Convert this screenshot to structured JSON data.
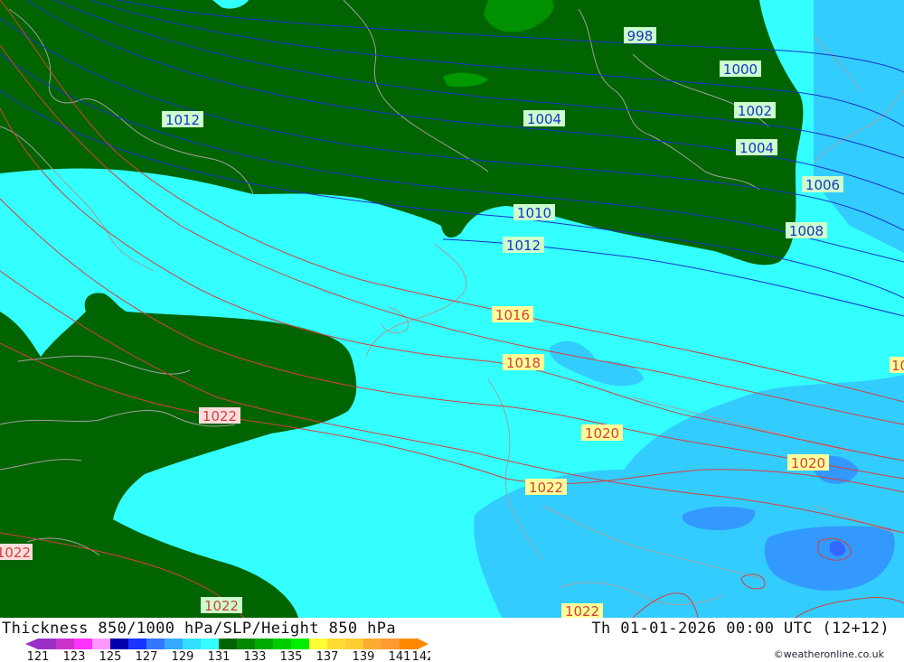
{
  "map": {
    "colors": {
      "land_green": "#006400",
      "cyan": "#33ffff",
      "light_blue": "#33ccff",
      "mid_blue": "#3399ff",
      "dark_blue": "#3366ff",
      "isobar_blue": "#1a33cc",
      "isobar_red": "#d24040",
      "coast": "#a0a0a0"
    },
    "labels": {
      "slp": [
        "998",
        "1000",
        "1002",
        "1004",
        "1006",
        "1008",
        "1010",
        "1012",
        "1004",
        "1012",
        "1016",
        "1018",
        "1020",
        "1020",
        "1022",
        "1022",
        "1022",
        "1022",
        "1022",
        "10"
      ]
    }
  },
  "footer": {
    "title": "Thickness 850/1000 hPa/SLP/Height 850 hPa",
    "datetime": "Th 01-01-2026 00:00 UTC (12+12)",
    "credit": "©weatheronline.co.uk"
  },
  "legend": {
    "ticks": [
      "121",
      "123",
      "125",
      "127",
      "129",
      "131",
      "133",
      "135",
      "137",
      "139",
      "141",
      "142"
    ],
    "colors": [
      "#9b30c8",
      "#cc33cc",
      "#ff33ff",
      "#ff99ff",
      "#0000aa",
      "#1a33ff",
      "#3377ff",
      "#33aaff",
      "#33ddff",
      "#33ffff",
      "#006400",
      "#008800",
      "#00aa00",
      "#00cc00",
      "#00ee00",
      "#ffff33",
      "#ffdd33",
      "#ffcc33",
      "#ffaa33",
      "#ff9933",
      "#ff8800"
    ]
  }
}
